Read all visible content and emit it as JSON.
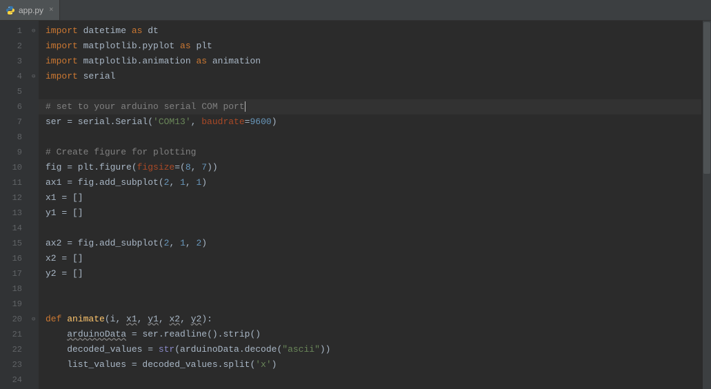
{
  "tab": {
    "filename": "app.py",
    "close_glyph": "×"
  },
  "editor": {
    "active_line": 6,
    "fold_markers": [
      1,
      4,
      20
    ],
    "lines": [
      {
        "n": 1,
        "tokens": [
          [
            "kw",
            "import"
          ],
          [
            "nm",
            " datetime "
          ],
          [
            "kw",
            "as"
          ],
          [
            "nm",
            " dt"
          ]
        ]
      },
      {
        "n": 2,
        "tokens": [
          [
            "kw",
            "import"
          ],
          [
            "nm",
            " matplotlib.pyplot "
          ],
          [
            "kw",
            "as"
          ],
          [
            "nm",
            " plt"
          ]
        ]
      },
      {
        "n": 3,
        "tokens": [
          [
            "kw",
            "import"
          ],
          [
            "nm",
            " matplotlib.animation "
          ],
          [
            "kw",
            "as"
          ],
          [
            "nm",
            " animation"
          ]
        ]
      },
      {
        "n": 4,
        "tokens": [
          [
            "kw",
            "import"
          ],
          [
            "nm",
            " serial"
          ]
        ]
      },
      {
        "n": 5,
        "tokens": []
      },
      {
        "n": 6,
        "tokens": [
          [
            "cmt",
            "# set to your arduino serial COM port"
          ]
        ],
        "cursor_after": true
      },
      {
        "n": 7,
        "tokens": [
          [
            "nm",
            "ser = serial.Serial("
          ],
          [
            "str",
            "'COM13'"
          ],
          [
            "op",
            ", "
          ],
          [
            "kwarg",
            "baudrate"
          ],
          [
            "op",
            "="
          ],
          [
            "num",
            "9600"
          ],
          [
            "nm",
            ")"
          ]
        ]
      },
      {
        "n": 8,
        "tokens": []
      },
      {
        "n": 9,
        "tokens": [
          [
            "cmt",
            "# Create figure for plotting"
          ]
        ]
      },
      {
        "n": 10,
        "tokens": [
          [
            "nm",
            "fig = plt.figure("
          ],
          [
            "kwarg",
            "figsize"
          ],
          [
            "op",
            "=("
          ],
          [
            "num",
            "8"
          ],
          [
            "op",
            ", "
          ],
          [
            "num",
            "7"
          ],
          [
            "nm",
            "))"
          ]
        ]
      },
      {
        "n": 11,
        "tokens": [
          [
            "nm",
            "ax1 = fig.add_subplot("
          ],
          [
            "num",
            "2"
          ],
          [
            "op",
            ", "
          ],
          [
            "num",
            "1"
          ],
          [
            "op",
            ", "
          ],
          [
            "num",
            "1"
          ],
          [
            "nm",
            ")"
          ]
        ]
      },
      {
        "n": 12,
        "tokens": [
          [
            "nm",
            "x1 = []"
          ]
        ]
      },
      {
        "n": 13,
        "tokens": [
          [
            "nm",
            "y1 = []"
          ]
        ]
      },
      {
        "n": 14,
        "tokens": []
      },
      {
        "n": 15,
        "tokens": [
          [
            "nm",
            "ax2 = fig.add_subplot("
          ],
          [
            "num",
            "2"
          ],
          [
            "op",
            ", "
          ],
          [
            "num",
            "1"
          ],
          [
            "op",
            ", "
          ],
          [
            "num",
            "2"
          ],
          [
            "nm",
            ")"
          ]
        ]
      },
      {
        "n": 16,
        "tokens": [
          [
            "nm",
            "x2 = []"
          ]
        ]
      },
      {
        "n": 17,
        "tokens": [
          [
            "nm",
            "y2 = []"
          ]
        ]
      },
      {
        "n": 18,
        "tokens": []
      },
      {
        "n": 19,
        "tokens": []
      },
      {
        "n": 20,
        "tokens": [
          [
            "kw",
            "def "
          ],
          [
            "fn",
            "animate"
          ],
          [
            "nm",
            "(i"
          ],
          [
            "op",
            ", "
          ],
          [
            "nm wavy",
            "x1"
          ],
          [
            "op",
            ", "
          ],
          [
            "nm wavy",
            "y1"
          ],
          [
            "op",
            ", "
          ],
          [
            "nm wavy",
            "x2"
          ],
          [
            "op",
            ", "
          ],
          [
            "nm wavy",
            "y2"
          ],
          [
            "nm",
            "):"
          ]
        ]
      },
      {
        "n": 21,
        "tokens": [
          [
            "nm",
            "    "
          ],
          [
            "nm wavy",
            "arduinoData"
          ],
          [
            "nm",
            " = ser.readline().strip()"
          ]
        ]
      },
      {
        "n": 22,
        "tokens": [
          [
            "nm",
            "    decoded_values = "
          ],
          [
            "builtin",
            "str"
          ],
          [
            "nm",
            "(arduinoData.decode("
          ],
          [
            "str",
            "\"ascii\""
          ],
          [
            "nm",
            "))"
          ]
        ]
      },
      {
        "n": 23,
        "tokens": [
          [
            "nm",
            "    list_values = decoded_values.split("
          ],
          [
            "str",
            "'x'"
          ],
          [
            "nm",
            ")"
          ]
        ]
      },
      {
        "n": 24,
        "tokens": []
      }
    ]
  }
}
